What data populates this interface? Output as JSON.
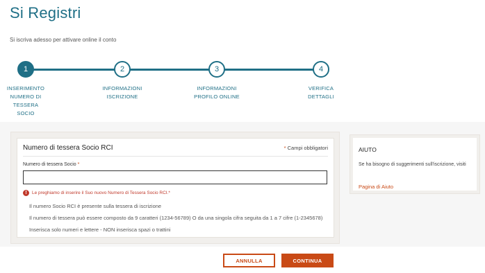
{
  "header": {
    "title": "Si Registri",
    "subtitle": "Si iscriva adesso per attivare online il conto"
  },
  "stepper": {
    "active_step": 1,
    "steps": [
      {
        "number": "1",
        "label_lines": [
          "INSERIMENTO",
          "NUMERO DI",
          "TESSERA",
          "SOCIO"
        ]
      },
      {
        "number": "2",
        "label_lines": [
          "INFORMAZIONI",
          "ISCRIZIONE"
        ]
      },
      {
        "number": "3",
        "label_lines": [
          "INFORMAZIONI",
          "PROFILO ONLINE"
        ]
      },
      {
        "number": "4",
        "label_lines": [
          "VERIFICA",
          "DETTAGLI"
        ]
      }
    ]
  },
  "form": {
    "heading": "Numero di tessera Socio RCI",
    "required_note_star": "*",
    "required_note": "Campi obbligatori",
    "field_label": "Numero di tessera Socio",
    "field_label_star": "*",
    "field_value": "",
    "field_placeholder": "",
    "error_icon_glyph": "!",
    "error_message": "Le preghiamo di inserire il Suo nuovo Numero di Tessera Socio RCI.*",
    "hints": [
      "Il numero Socio RCI è presente sulla tessera di iscrizione",
      "Il numero di tessera può essere composto da 9 caratteri (1234-56789) O da una singola cifra seguita da 1 a 7 cifre (1-2345678)",
      "Inserisca solo numeri e lettere - NON inserisca spazi o trattini"
    ]
  },
  "help": {
    "title": "AIUTO",
    "text": "Se ha bisogno di suggerimenti sull'iscrizione, visiti",
    "link": "Pagina di Aiuto"
  },
  "actions": {
    "cancel_label": "ANNULLA",
    "continue_label": "CONTINUA"
  },
  "colors": {
    "brand_teal": "#1f6f86",
    "accent_orange": "#c94a16",
    "error_red": "#c0392b"
  }
}
